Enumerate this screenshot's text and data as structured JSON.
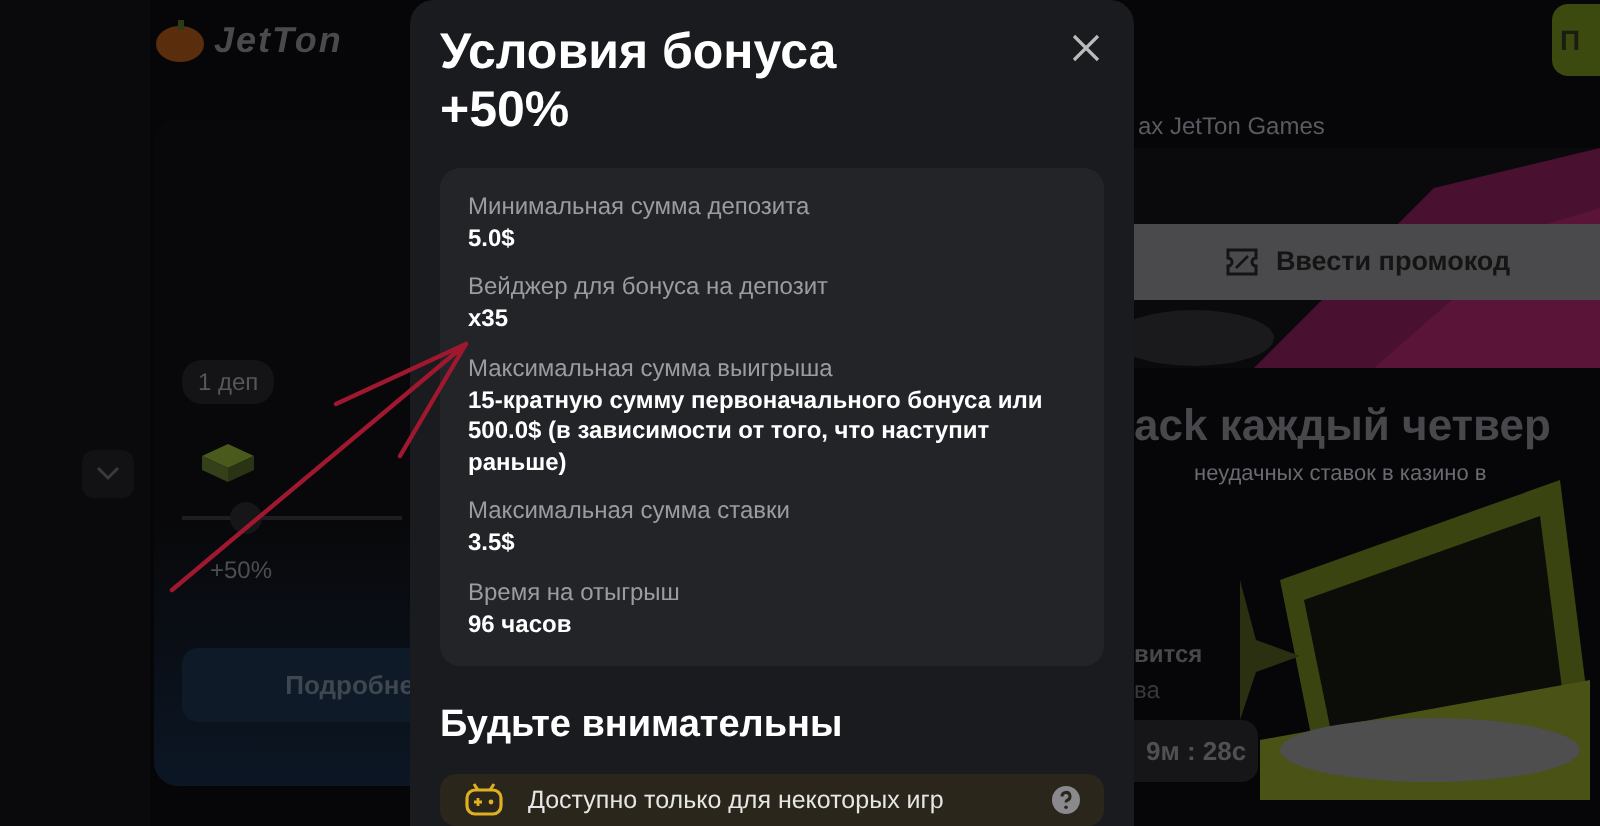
{
  "logo": "JetTon",
  "bonus_card": {
    "step_label": "1 деп",
    "bonus": "+50%",
    "details_button": "Подробне"
  },
  "right_panel": {
    "top_button": "П",
    "subtitle": "ах JetTon Games",
    "promo_button": "Ввести промокод",
    "cashback_title": "ack каждый четвер",
    "cashback_text": "неудачных ставок в казино в",
    "status": "вится",
    "status_sub": "ва",
    "timer": "9м : 28с"
  },
  "modal": {
    "title": "Условия бонуса +50%",
    "conditions": [
      {
        "label": "Минимальная сумма депозита",
        "value": "5.0$"
      },
      {
        "label": "Вейджер для бонуса на депозит",
        "value": "x35"
      },
      {
        "label": "Максимальная сумма выигрыша",
        "value": "15-кратную сумму первоначального бонуса или 500.0$ (в зависимости от того, что наступит раньше)"
      },
      {
        "label": "Максимальная сумма ставки",
        "value": "3.5$"
      },
      {
        "label": "Время на отыгрыш",
        "value": "96 часов"
      }
    ],
    "warning_heading": "Будьте внимательны",
    "notice": "Доступно только для некоторых игр"
  }
}
